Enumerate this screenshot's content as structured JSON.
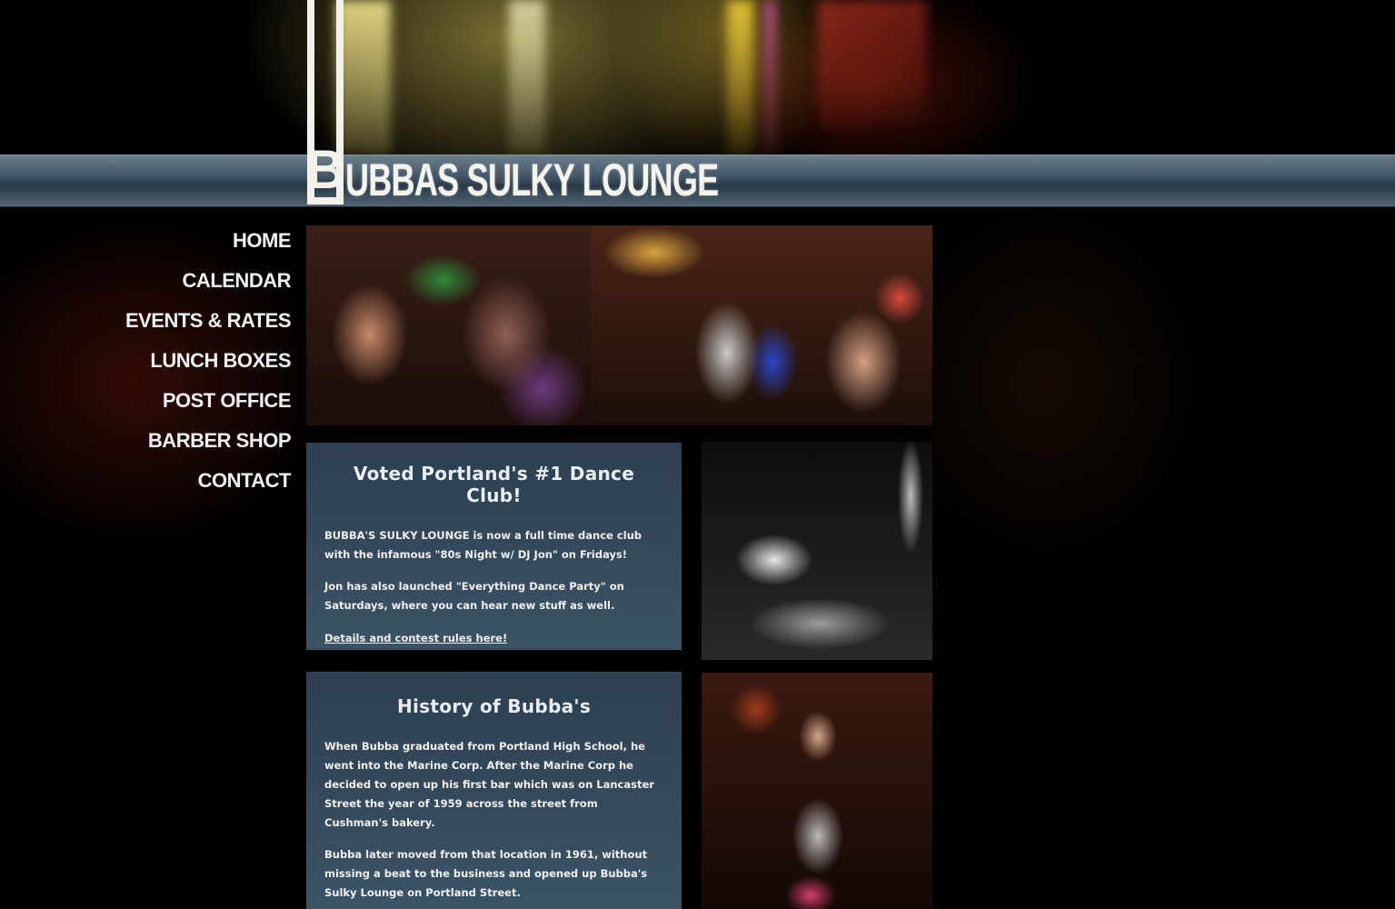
{
  "site": {
    "logo_initial": "B",
    "logo_text": "UBBAS SULKY LOUNGE"
  },
  "nav": {
    "items": [
      {
        "label": "HOME"
      },
      {
        "label": "CALENDAR"
      },
      {
        "label": "EVENTS & RATES"
      },
      {
        "label": "LUNCH BOXES"
      },
      {
        "label": "POST OFFICE"
      },
      {
        "label": "BARBER SHOP"
      },
      {
        "label": "CONTACT"
      }
    ]
  },
  "panels": {
    "dance": {
      "title": "Voted Portland's #1 Dance Club!",
      "para1": "BUBBA'S SULKY LOUNGE is now a full time dance club with the infamous \"80s Night w/ DJ Jon\" on Fridays!",
      "para2": "Jon has also launched \"Everything Dance Party\" on Saturdays, where you can hear new stuff as well.",
      "link": "Details and contest rules here!"
    },
    "history": {
      "title": "History of Bubba's",
      "para1": "When Bubba graduated from Portland High School, he went into the Marine Corp. After the Marine Corp he decided to open up his first bar which was on Lancaster Street the year of 1959 across the street from Cushman's bakery.",
      "para2": "Bubba later moved from that location in 1961, without missing a beat to the business and opened up Bubba's Sulky Lounge on Portland Street."
    }
  },
  "colors": {
    "header_bar": "#3f5262",
    "panel": "#34495b",
    "text": "#f0f0f0"
  }
}
